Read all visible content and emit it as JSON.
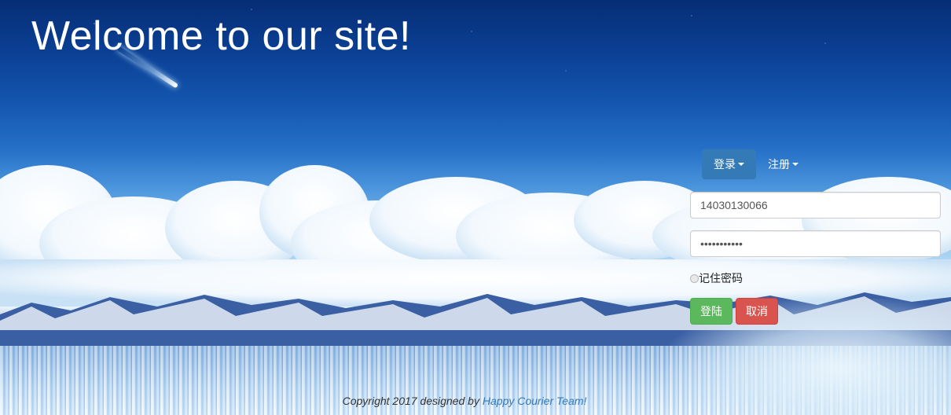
{
  "header": {
    "title": "Welcome to our site!"
  },
  "nav": {
    "tabs": [
      {
        "label": "登录",
        "active": true
      },
      {
        "label": "注册",
        "active": false
      }
    ]
  },
  "login_form": {
    "username_value": "14030130066",
    "password_value": "•••••••••••",
    "remember_label": "记住密码",
    "submit_label": "登陆",
    "cancel_label": "取消"
  },
  "footer": {
    "text": "Copyright 2017 designed by",
    "team_link": "Happy Courier Team!"
  },
  "colors": {
    "primary": "#337ab7",
    "success": "#5cb85c",
    "danger": "#d9534f"
  },
  "icons": [
    "caret-down-icon",
    "comet-decoration"
  ]
}
